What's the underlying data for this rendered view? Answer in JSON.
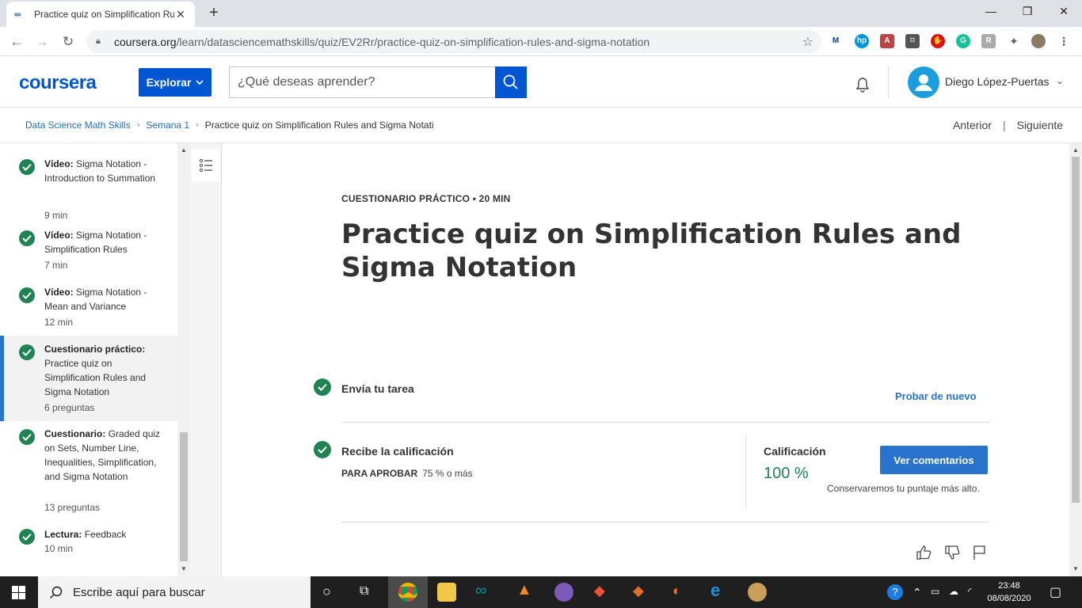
{
  "browser": {
    "tab_title": "Practice quiz on Simplification Ru",
    "tab_favicon": "∞",
    "url_host": "coursera.org",
    "url_path": "/learn/datasciencemathskills/quiz/EV2Rr/practice-quiz-on-simplification-rules-and-sigma-notation"
  },
  "header": {
    "logo": "coursera",
    "explore_label": "Explorar",
    "search_placeholder": "¿Qué deseas aprender?",
    "user_name": "Diego López-Puertas"
  },
  "breadcrumb": {
    "course": "Data Science Math Skills",
    "week": "Semana 1",
    "current": "Practice quiz on Simplification Rules and Sigma Notati",
    "prev": "Anterior",
    "next": "Siguiente"
  },
  "sidebar": {
    "items": [
      {
        "type": "Vídeo:",
        "title": "Sigma Notation - Introduction to Summation",
        "duration": "9 min"
      },
      {
        "type": "Vídeo:",
        "title": "Sigma Notation - Simplification Rules",
        "duration": "7 min"
      },
      {
        "type": "Vídeo:",
        "title": "Sigma Notation - Mean and Variance",
        "duration": "12 min"
      },
      {
        "type": "Cuestionario práctico:",
        "title": "Practice quiz on Simplification Rules and Sigma Notation",
        "duration": "6 preguntas"
      },
      {
        "type": "Cuestionario:",
        "title": "Graded quiz on Sets, Number Line, Inequalities, Simplification, and Sigma Notation",
        "duration": "13 preguntas"
      },
      {
        "type": "Lectura:",
        "title": "Feedback",
        "duration": "10 min"
      }
    ]
  },
  "main": {
    "kicker": "CUESTIONARIO PRÁCTICO • 20 MIN",
    "title": "Practice quiz on Simplification Rules and Sigma Notation",
    "step1": "Envía tu tarea",
    "retry": "Probar de nuevo",
    "step2": "Recibe la calificación",
    "pass_label": "PARA APROBAR",
    "pass_value": "75 % o más",
    "grade_label": "Calificación",
    "grade_value": "100 %",
    "view_feedback": "Ver comentarios",
    "keep_note": "Conservaremos tu puntaje más alto."
  },
  "taskbar": {
    "search": "Escribe aquí para buscar",
    "time": "23:48",
    "date": "08/08/2020"
  },
  "colors": {
    "brand": "#0056d2",
    "accent": "#2a73cc",
    "success": "#1f8354"
  }
}
